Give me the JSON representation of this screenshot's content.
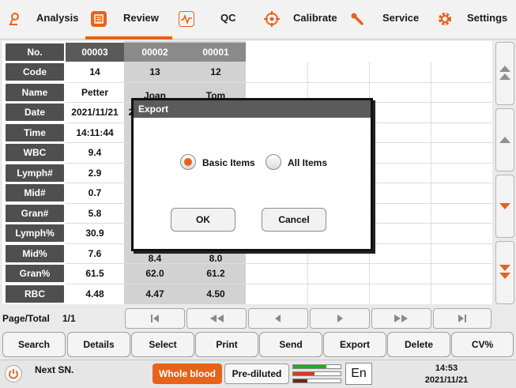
{
  "nav": {
    "items": [
      {
        "label": "Analysis",
        "icon": "microscope-icon"
      },
      {
        "label": "Review",
        "icon": "list-icon"
      },
      {
        "label": "QC",
        "icon": "pulse-icon"
      },
      {
        "label": "Calibrate",
        "icon": "target-icon"
      },
      {
        "label": "Service",
        "icon": "wrench-icon"
      },
      {
        "label": "Settings",
        "icon": "gear-icon"
      }
    ],
    "active": "Review",
    "accent": "#e8631a"
  },
  "table": {
    "row_headers": [
      "No.",
      "Code",
      "Name",
      "Date",
      "Time",
      "WBC",
      "Lymph#",
      "Mid#",
      "Gran#",
      "Lymph%",
      "Mid%",
      "Gran%",
      "RBC"
    ],
    "columns": [
      {
        "no": "00003",
        "code": "14",
        "name": "Petter",
        "date": "2021/11/21",
        "time": "14:11:44",
        "wbc": "9.4",
        "lymph_num": "2.9",
        "mid_num": "0.7",
        "gran_num": "5.8",
        "lymph_pct": "30.9",
        "mid_pct": "7.6",
        "gran_pct": "61.5",
        "rbc": "4.48"
      },
      {
        "no": "00002",
        "code": "13",
        "name": "Joan",
        "date": "2",
        "mid_pct": "8.4",
        "gran_pct": "62.0",
        "rbc": "4.47"
      },
      {
        "no": "00001",
        "code": "12",
        "name": "Tom",
        "mid_pct": "8.0",
        "gran_pct": "61.2",
        "rbc": "4.50"
      }
    ]
  },
  "pager": {
    "label": "Page/Total",
    "value": "1/1"
  },
  "toolbar": [
    "Search",
    "Details",
    "Select",
    "Print",
    "Send",
    "Export",
    "Delete",
    "CV%"
  ],
  "status": {
    "next_sn_label": "Next SN.",
    "mode_whole_blood": "Whole blood",
    "mode_prediluted": "Pre-diluted",
    "lang": "En",
    "time": "14:53",
    "date": "2021/11/21"
  },
  "dialog": {
    "title": "Export",
    "option_basic": "Basic Items",
    "option_all": "All Items",
    "selected": "Basic Items",
    "ok": "OK",
    "cancel": "Cancel"
  }
}
